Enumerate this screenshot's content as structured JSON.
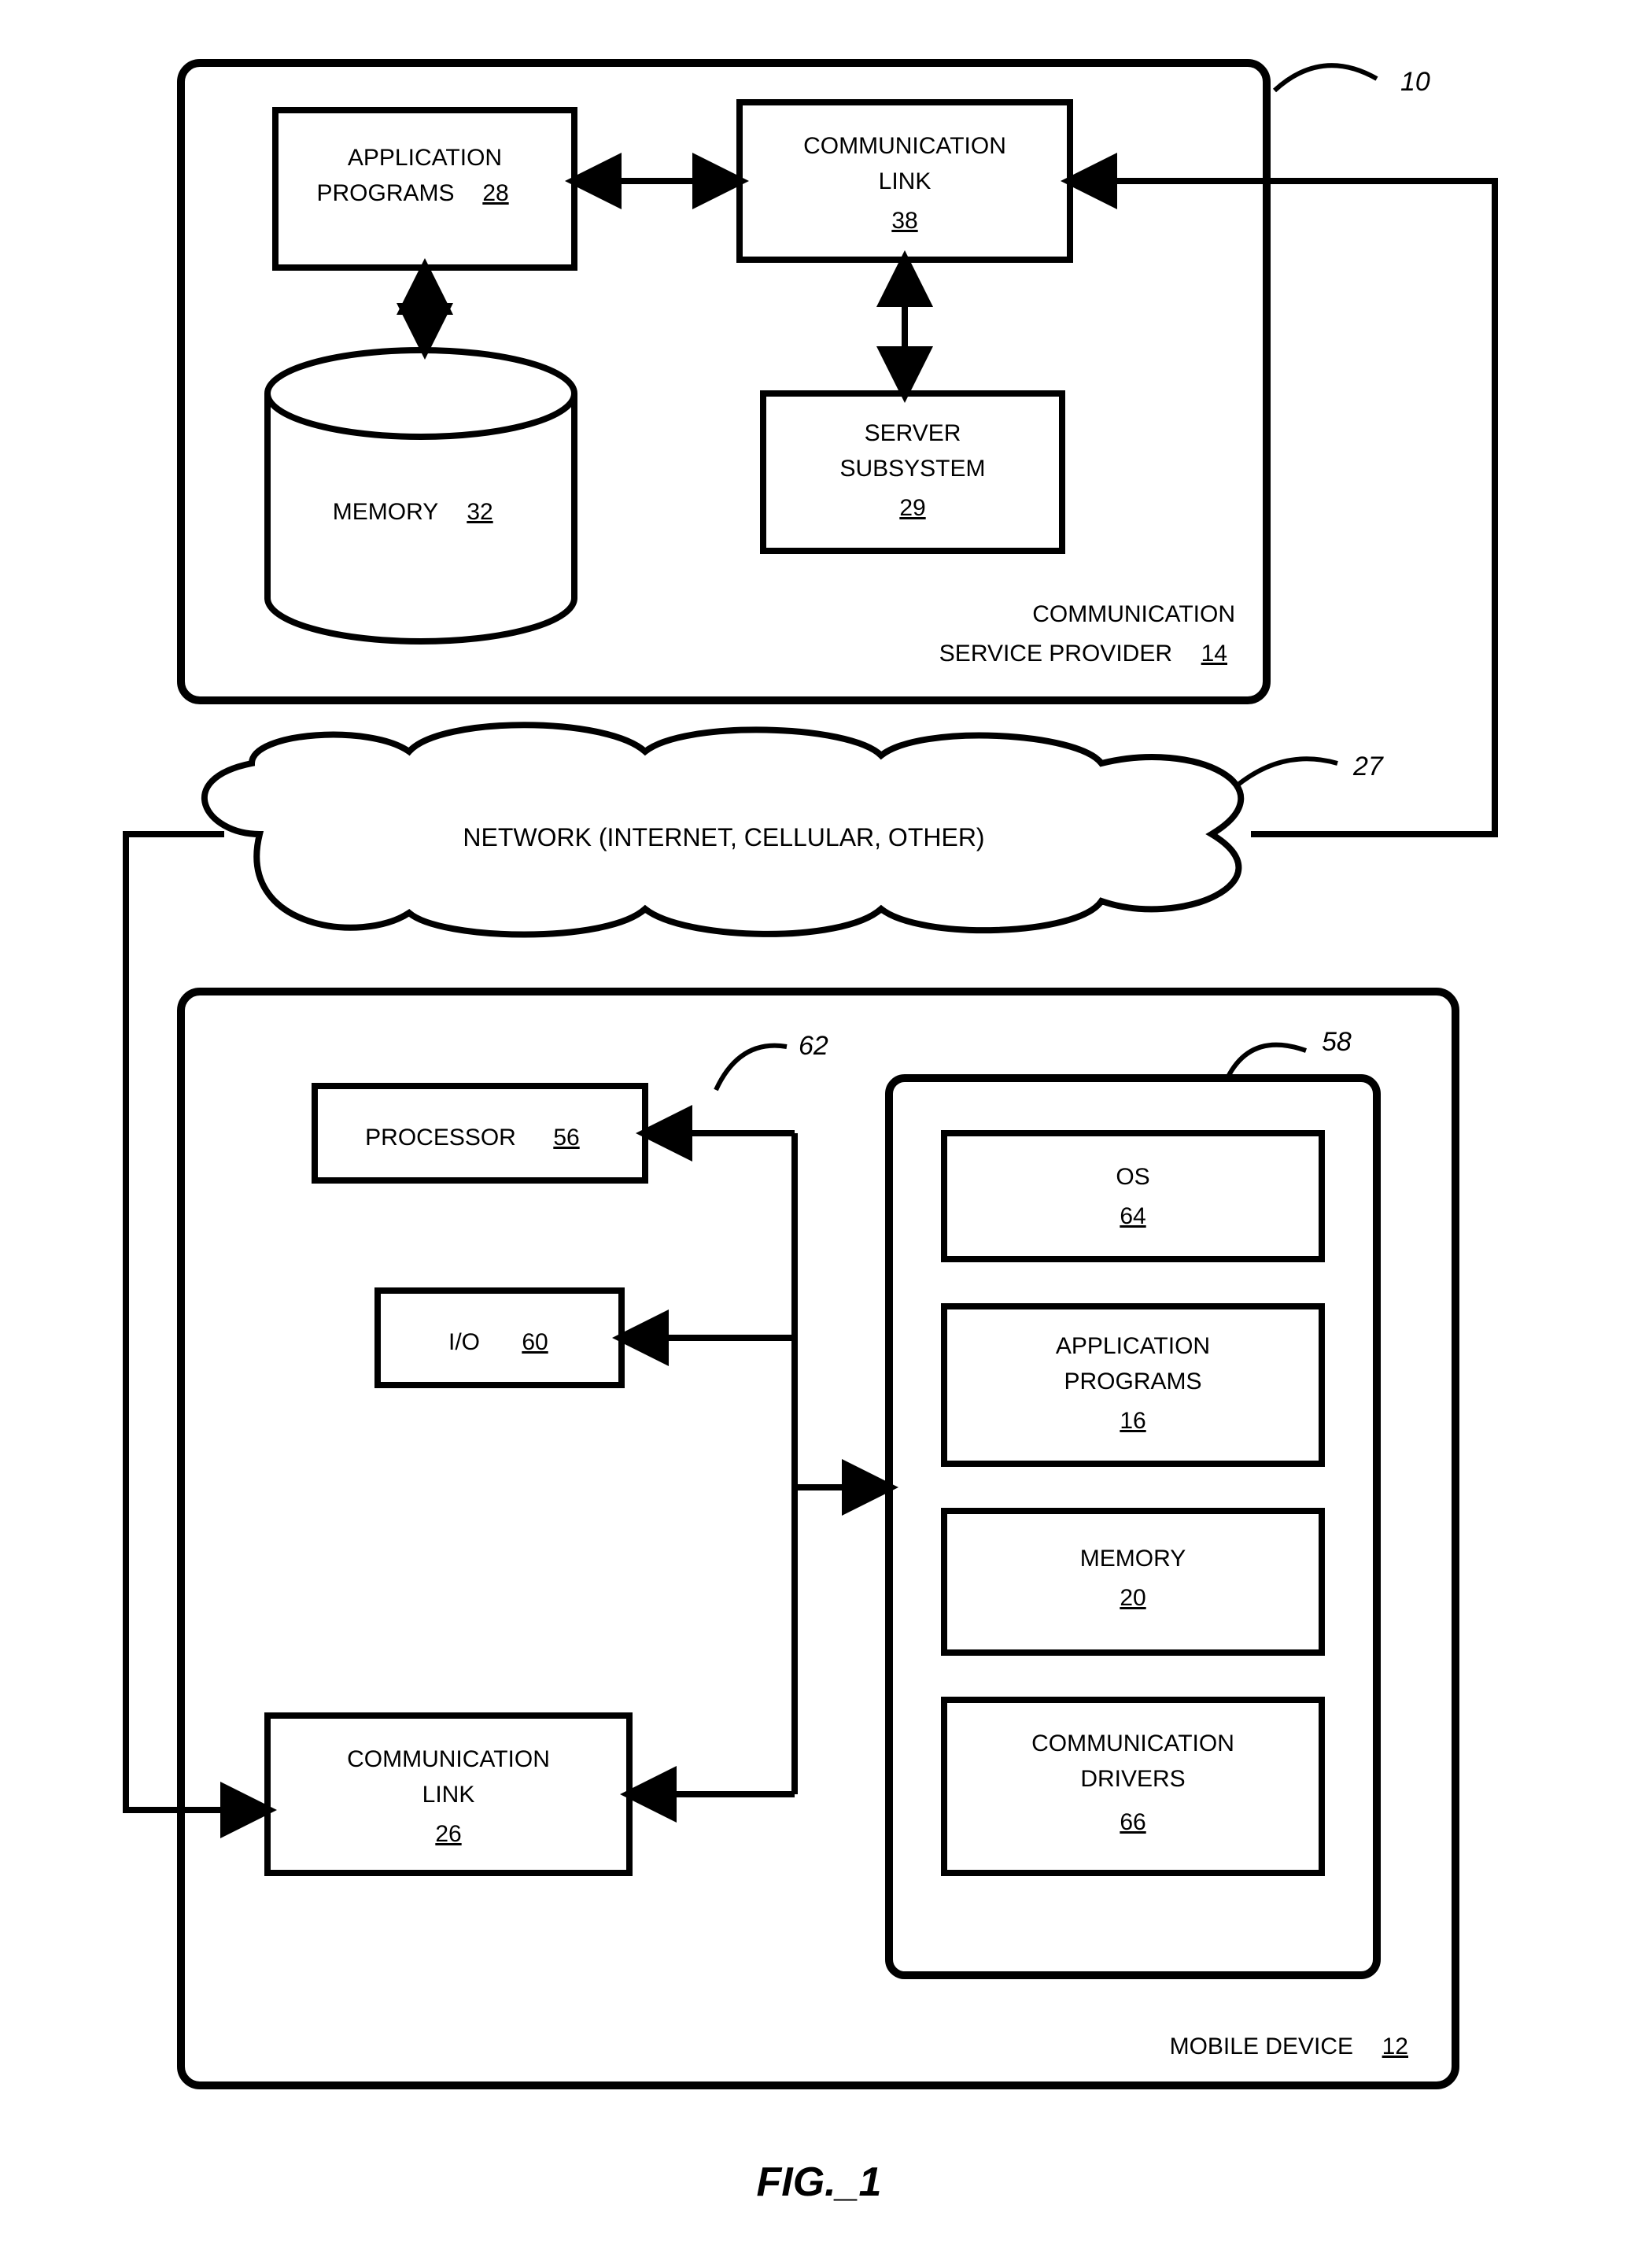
{
  "figure_caption": "FIG._1",
  "system_ref": "10",
  "network_ref": "27",
  "bus_refs": {
    "top_bus": "62",
    "module_box": "58"
  },
  "provider": {
    "label_line1": "COMMUNICATION",
    "label_line2": "SERVICE PROVIDER",
    "num": "14",
    "app_programs": {
      "line1": "APPLICATION",
      "line2": "PROGRAMS",
      "num": "28"
    },
    "comm_link": {
      "line1": "COMMUNICATION",
      "line2": "LINK",
      "num": "38"
    },
    "memory": {
      "label": "MEMORY",
      "num": "32"
    },
    "server": {
      "line1": "SERVER",
      "line2": "SUBSYSTEM",
      "num": "29"
    }
  },
  "network": {
    "text": "NETWORK (INTERNET, CELLULAR, OTHER)"
  },
  "device": {
    "label": "MOBILE DEVICE",
    "num": "12",
    "processor": {
      "label": "PROCESSOR",
      "num": "56"
    },
    "io": {
      "label": "I/O",
      "num": "60"
    },
    "comm_link": {
      "line1": "COMMUNICATION",
      "line2": "LINK",
      "num": "26"
    },
    "module": {
      "os": {
        "label": "OS",
        "num": "64"
      },
      "apps": {
        "line1": "APPLICATION",
        "line2": "PROGRAMS",
        "num": "16"
      },
      "memory": {
        "label": "MEMORY",
        "num": "20"
      },
      "drivers": {
        "line1": "COMMUNICATION",
        "line2": "DRIVERS",
        "num": "66"
      }
    }
  },
  "chart_data": {
    "type": "diagram",
    "title": "System architecture: communication service provider and mobile device over a network",
    "nodes": [
      {
        "id": "csp",
        "label": "Communication Service Provider 14",
        "kind": "container"
      },
      {
        "id": "app28",
        "label": "Application Programs 28",
        "parent": "csp"
      },
      {
        "id": "cl38",
        "label": "Communication Link 38",
        "parent": "csp"
      },
      {
        "id": "mem32",
        "label": "Memory 32",
        "parent": "csp",
        "shape": "cylinder"
      },
      {
        "id": "srv29",
        "label": "Server Subsystem 29",
        "parent": "csp"
      },
      {
        "id": "net27",
        "label": "Network (Internet, Cellular, Other) 27",
        "shape": "cloud"
      },
      {
        "id": "md",
        "label": "Mobile Device 12",
        "kind": "container"
      },
      {
        "id": "proc56",
        "label": "Processor 56",
        "parent": "md"
      },
      {
        "id": "io60",
        "label": "I/O 60",
        "parent": "md"
      },
      {
        "id": "cl26",
        "label": "Communication Link 26",
        "parent": "md"
      },
      {
        "id": "mod58",
        "label": "Module Box 58",
        "parent": "md",
        "kind": "container"
      },
      {
        "id": "os64",
        "label": "OS 64",
        "parent": "mod58"
      },
      {
        "id": "apps16",
        "label": "Application Programs 16",
        "parent": "mod58"
      },
      {
        "id": "mem20",
        "label": "Memory 20",
        "parent": "mod58"
      },
      {
        "id": "drv66",
        "label": "Communication Drivers 66",
        "parent": "mod58"
      }
    ],
    "edges": [
      {
        "from": "app28",
        "to": "cl38",
        "dir": "both"
      },
      {
        "from": "app28",
        "to": "mem32",
        "dir": "both"
      },
      {
        "from": "cl38",
        "to": "srv29",
        "dir": "both"
      },
      {
        "from": "cl38",
        "to": "net27",
        "dir": "one",
        "via": "external"
      },
      {
        "from": "net27",
        "to": "cl26",
        "dir": "one",
        "via": "external"
      },
      {
        "from": "proc56",
        "to": "bus62",
        "dir": "bus"
      },
      {
        "from": "io60",
        "to": "bus62",
        "dir": "bus"
      },
      {
        "from": "cl26",
        "to": "bus62",
        "dir": "bus"
      },
      {
        "from": "bus62",
        "to": "mod58",
        "dir": "bus"
      }
    ]
  }
}
